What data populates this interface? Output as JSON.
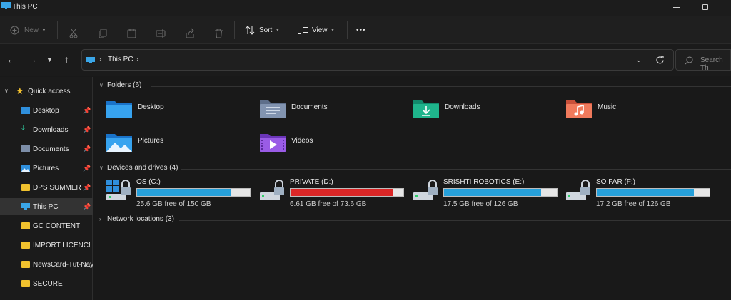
{
  "window": {
    "title": "This PC"
  },
  "toolbar": {
    "new_label": "New",
    "sort_label": "Sort",
    "view_label": "View",
    "more_label": "•••"
  },
  "address": {
    "crumbs": [
      "This PC"
    ],
    "search_placeholder": "Search Th"
  },
  "sidebar": {
    "quick_access": "Quick access",
    "items": [
      {
        "label": "Desktop",
        "pinned": true
      },
      {
        "label": "Downloads",
        "pinned": true
      },
      {
        "label": "Documents",
        "pinned": true
      },
      {
        "label": "Pictures",
        "pinned": true
      },
      {
        "label": "DPS SUMMER C",
        "pinned": true
      },
      {
        "label": "This PC",
        "pinned": true,
        "selected": true
      },
      {
        "label": "GC CONTENT",
        "pinned": false
      },
      {
        "label": "IMPORT LICENCE",
        "pinned": false
      },
      {
        "label": "NewsCard-Tut-Nay",
        "pinned": false
      },
      {
        "label": "SECURE",
        "pinned": false
      }
    ]
  },
  "main": {
    "folders_title": "Folders (6)",
    "folders": [
      {
        "label": "Desktop",
        "icon": "desktop-folder-icon"
      },
      {
        "label": "Documents",
        "icon": "documents-folder-icon"
      },
      {
        "label": "Downloads",
        "icon": "downloads-folder-icon"
      },
      {
        "label": "Music",
        "icon": "music-folder-icon"
      },
      {
        "label": "Pictures",
        "icon": "pictures-folder-icon"
      },
      {
        "label": "Videos",
        "icon": "videos-folder-icon"
      }
    ],
    "devices_title": "Devices and drives (4)",
    "drives": [
      {
        "name": "OS (C:)",
        "free": "25.6 GB free of 150 GB",
        "used_fraction": 0.83,
        "bar_color": "#26a0da"
      },
      {
        "name": "PRIVATE (D:)",
        "free": "6.61 GB free of 73.6 GB",
        "used_fraction": 0.91,
        "bar_color": "#da2626"
      },
      {
        "name": "SRISHTI ROBOTICS (E:)",
        "free": "17.5 GB free of 126 GB",
        "used_fraction": 0.86,
        "bar_color": "#26a0da"
      },
      {
        "name": "SO FAR (F:)",
        "free": "17.2 GB free of 126 GB",
        "used_fraction": 0.86,
        "bar_color": "#26a0da"
      }
    ],
    "network_title": "Network locations (3)"
  }
}
